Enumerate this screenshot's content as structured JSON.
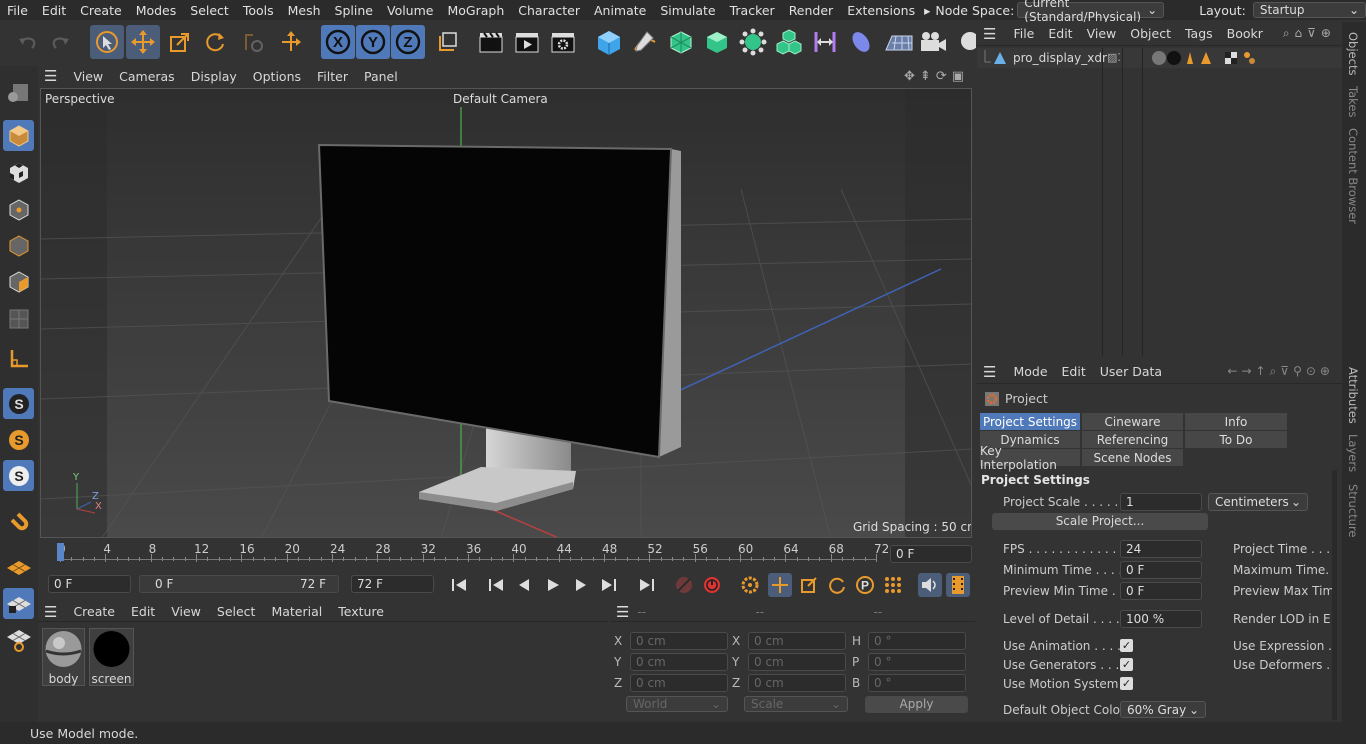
{
  "menubar": {
    "items": [
      "File",
      "Edit",
      "Create",
      "Modes",
      "Select",
      "Tools",
      "Mesh",
      "Spline",
      "Volume",
      "MoGraph",
      "Character",
      "Animate",
      "Simulate",
      "Tracker",
      "Render",
      "Extensions"
    ],
    "more": "▸",
    "node_space_label": "Node Space:",
    "node_space_value": "Current (Standard/Physical)",
    "layout_label": "Layout:",
    "layout_value": "Startup"
  },
  "toolbar": {
    "axes": [
      "X",
      "Y",
      "Z"
    ]
  },
  "viewport": {
    "menu": [
      "View",
      "Cameras",
      "Display",
      "Options",
      "Filter",
      "Panel"
    ],
    "label": "Perspective",
    "camera": "Default Camera",
    "grid_spacing": "Grid Spacing : 50 cm",
    "axis_labels": [
      "Y",
      "Z",
      "X"
    ]
  },
  "timeline": {
    "ticks": [
      "0",
      "4",
      "8",
      "12",
      "16",
      "20",
      "24",
      "28",
      "32",
      "36",
      "40",
      "44",
      "48",
      "52",
      "56",
      "60",
      "64",
      "68",
      "72"
    ],
    "current_frame": "0 F"
  },
  "playbar": {
    "start": "0 F",
    "range_start": "0 F",
    "range_end": "72 F",
    "end": "72 F"
  },
  "material_panel": {
    "menu": [
      "Create",
      "Edit",
      "View",
      "Select",
      "Material",
      "Texture"
    ],
    "materials": [
      "body",
      "screen"
    ]
  },
  "coord_panel": {
    "header": [
      "--",
      "--",
      "--"
    ],
    "rows": [
      {
        "a": "X",
        "av": "0 cm",
        "b": "X",
        "bv": "0 cm",
        "c": "H",
        "cv": "0 °"
      },
      {
        "a": "Y",
        "av": "0 cm",
        "b": "Y",
        "bv": "0 cm",
        "c": "P",
        "cv": "0 °"
      },
      {
        "a": "Z",
        "av": "0 cm",
        "b": "Z",
        "bv": "0 cm",
        "c": "B",
        "cv": "0 °"
      }
    ],
    "world": "World",
    "scale": "Scale",
    "apply": "Apply"
  },
  "object_panel": {
    "menu": [
      "File",
      "Edit",
      "View",
      "Object",
      "Tags",
      "Bookr"
    ],
    "object_name": "pro_display_xdr"
  },
  "attr_panel": {
    "menu": [
      "Mode",
      "Edit",
      "User Data"
    ],
    "title": "Project",
    "tabs": [
      "Project Settings",
      "Cineware",
      "Info",
      "Dynamics",
      "Referencing",
      "To Do",
      "Key Interpolation",
      "Scene Nodes"
    ],
    "section": "Project Settings",
    "project_scale_label": "Project Scale . . . . .",
    "project_scale_value": "1",
    "project_scale_unit": "Centimeters",
    "scale_button": "Scale Project...",
    "fps_label": "FPS . . . . . . . . . . . . .",
    "fps_value": "24",
    "project_time_label": "Project Time . . .",
    "min_time_label": "Minimum Time . . . .",
    "min_time_value": "0 F",
    "max_time_label": "Maximum Time.",
    "preview_min_label": "Preview Min Time . .",
    "preview_min_value": "0 F",
    "preview_max_label": "Preview Max Tim",
    "lod_label": "Level of Detail . . . . .",
    "lod_value": "100 %",
    "render_lod_label": "Render LOD in E",
    "use_animation": "Use Animation . . . .",
    "use_expression": "Use Expression .",
    "use_generators": "Use Generators . . . .",
    "use_deformers": "Use Deformers .",
    "use_motion": "Use Motion System",
    "default_color_label": "Default Object Color",
    "default_color_value": "60% Gray"
  },
  "right_tabs": [
    "Objects",
    "Takes",
    "Content Browser",
    "Attributes",
    "Layers",
    "Structure"
  ],
  "status": "Use Model mode.",
  "colors": {
    "accent": "#4f79b8",
    "bg": "#333333",
    "orange": "#e89a2c"
  }
}
